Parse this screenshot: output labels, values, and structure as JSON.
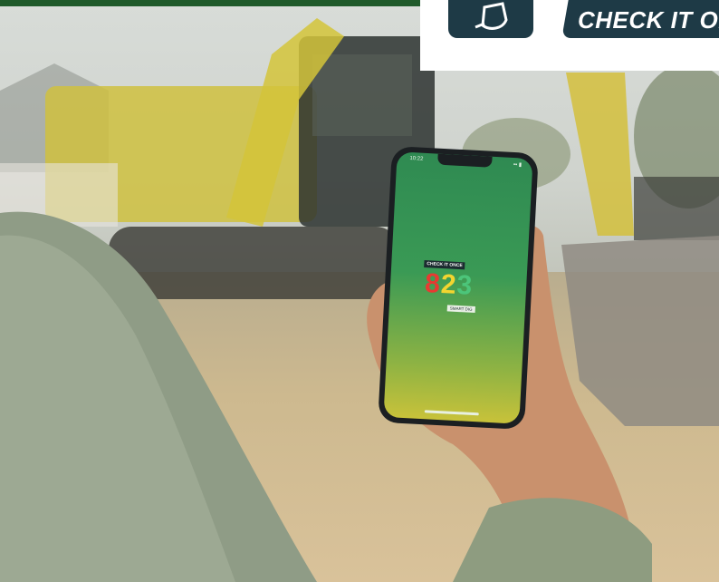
{
  "header": {
    "badge_text": "CHECK IT ON",
    "icon": "shovel-icon"
  },
  "phone_screen": {
    "status_time": "10:22",
    "status_icons": "signal-battery",
    "logo_top": "CHECK IT ONCE",
    "logo_main": [
      "8",
      "2",
      "3"
    ],
    "logo_sub": "SMART DIG"
  },
  "colors": {
    "header_bar": "#1f5a2a",
    "badge_bg": "#1e3a46",
    "screen_top": "#2f8a52",
    "screen_bottom": "#c8c23a"
  }
}
